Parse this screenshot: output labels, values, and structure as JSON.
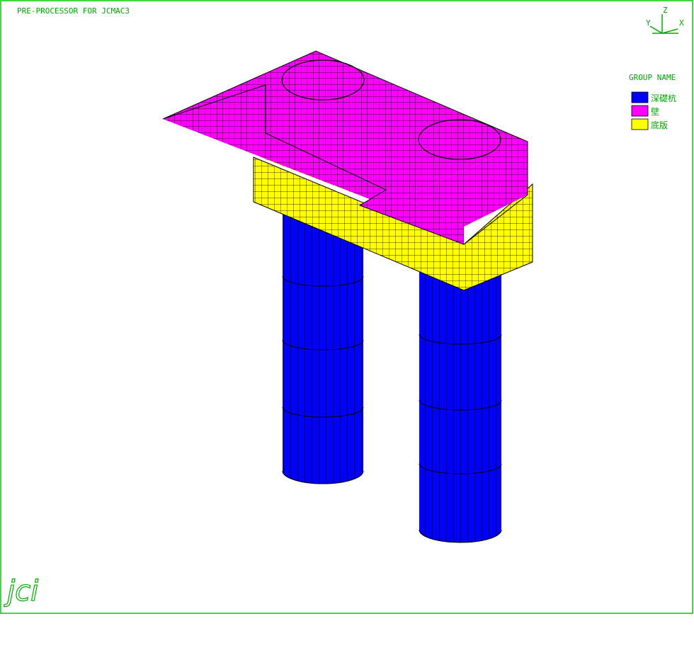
{
  "header": {
    "title": "PRE-PROCESSOR   FOR  JCMAC3"
  },
  "axis_triad": {
    "z": "Z",
    "y": "Y",
    "x": "X"
  },
  "legend": {
    "title": "GROUP NAME",
    "items": [
      {
        "label": "深礎杭",
        "color": "#0000ff"
      },
      {
        "label": "壁",
        "color": "#ff00ff"
      },
      {
        "label": "底版",
        "color": "#ffff00"
      }
    ]
  },
  "logo": {
    "text": "jci"
  },
  "colors": {
    "frame": "#00cc00",
    "text": "#00aa00",
    "mesh": "#000000"
  }
}
